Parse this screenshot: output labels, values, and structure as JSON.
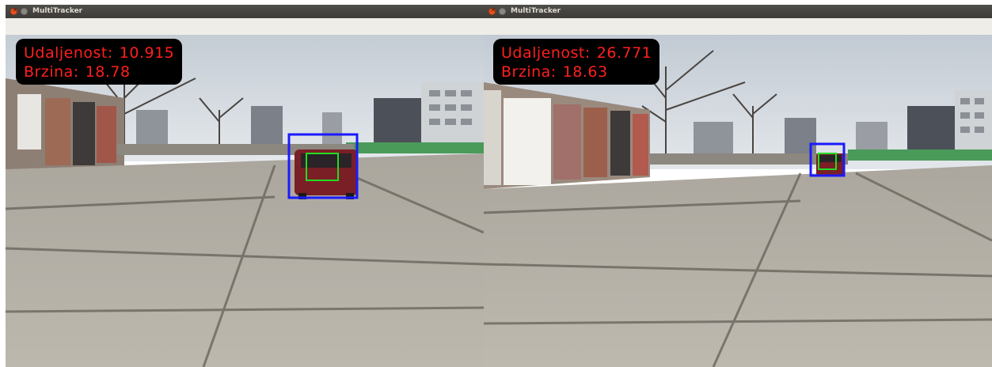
{
  "windows": [
    {
      "title": "MultiTracker",
      "overlay": {
        "distance_label": "Udaljenost:",
        "distance_value": "10.915",
        "speed_label": "Brzina:",
        "speed_value": "18.78"
      }
    },
    {
      "title": "MultiTracker",
      "overlay": {
        "distance_label": "Udaljenost:",
        "distance_value": "26.771",
        "speed_label": "Brzina:",
        "speed_value": "18.63"
      }
    }
  ],
  "colors": {
    "overlay_text": "#ff1f1f",
    "outer_box": "#1a1aff",
    "inner_box": "#22dd22",
    "titlebar": "#3c3b37",
    "close_button": "#e95420"
  },
  "icons": {
    "close": "close-icon",
    "minimize": "minimize-icon"
  }
}
